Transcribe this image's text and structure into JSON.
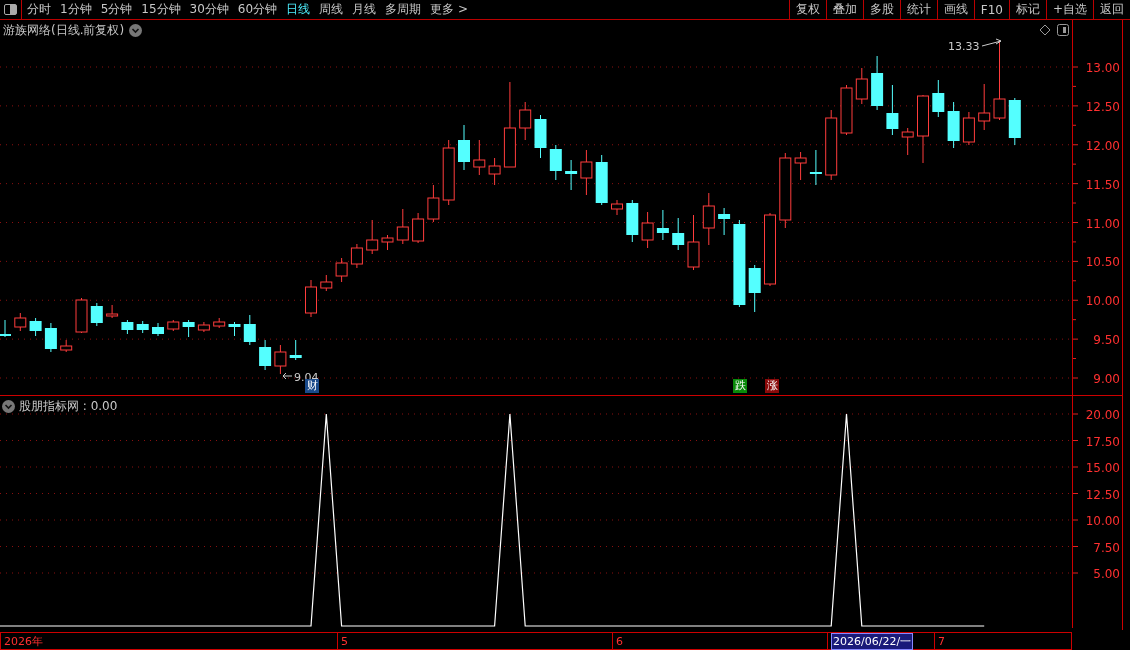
{
  "toolbar": {
    "periods": [
      {
        "label": "分时",
        "selected": false
      },
      {
        "label": "1分钟",
        "selected": false
      },
      {
        "label": "5分钟",
        "selected": false
      },
      {
        "label": "15分钟",
        "selected": false
      },
      {
        "label": "30分钟",
        "selected": false
      },
      {
        "label": "60分钟",
        "selected": false
      },
      {
        "label": "日线",
        "selected": true
      },
      {
        "label": "周线",
        "selected": false
      },
      {
        "label": "月线",
        "selected": false
      },
      {
        "label": "多周期",
        "selected": false
      },
      {
        "label": "更多 >",
        "selected": false
      }
    ],
    "buttons": [
      "复权",
      "叠加",
      "多股",
      "统计",
      "画线",
      "F10",
      "标记",
      "+自选",
      "返回"
    ]
  },
  "price_panel": {
    "title": "游族网络(日线.前复权)",
    "y_ticks": [
      "13.00",
      "12.50",
      "12.00",
      "11.50",
      "11.00",
      "10.50",
      "10.00",
      "9.50",
      "9.00"
    ],
    "high_label": "13.33",
    "low_label": "9.04",
    "markers": [
      {
        "text": "财",
        "kind": "finance"
      },
      {
        "text": "跌",
        "kind": "down"
      },
      {
        "text": "涨",
        "kind": "up"
      }
    ]
  },
  "indicator_panel": {
    "value": " : 0.00",
    "chart_data": {
      "type": "line",
      "grid": true,
      "series": [
        {
          "name": "股朋指标网",
          "color": "#ffffff",
          "values": [
            0,
            0,
            0,
            0,
            0,
            0,
            0,
            0,
            0,
            0,
            0,
            0,
            0,
            0,
            0,
            0,
            0,
            0,
            0,
            0,
            0,
            20,
            0,
            0,
            0,
            0,
            0,
            0,
            0,
            0,
            0,
            0,
            0,
            20,
            0,
            0,
            0,
            0,
            0,
            0,
            0,
            0,
            0,
            0,
            0,
            0,
            0,
            0,
            0,
            0,
            0,
            0,
            0,
            0,
            0,
            20,
            0,
            0,
            0,
            0,
            0,
            0,
            0,
            0,
            0
          ]
        }
      ],
      "ylim": [
        0,
        20
      ],
      "yticks": [
        {
          "value": 5,
          "label": "5.00"
        },
        {
          "value": 7.5,
          "label": "7.50"
        },
        {
          "value": 10,
          "label": "10.00"
        },
        {
          "value": 12.5,
          "label": "12.50"
        },
        {
          "value": 15,
          "label": "15.00"
        },
        {
          "value": 17.5,
          "label": "17.50"
        },
        {
          "value": 20,
          "label": "20.00"
        }
      ]
    }
  },
  "date_bar": [
    {
      "label": "2026年",
      "selected": false
    },
    {
      "label": "5",
      "selected": false
    },
    {
      "label": "6",
      "selected": false
    },
    {
      "label": "2026/06/22/一",
      "selected": true
    },
    {
      "label": "7",
      "selected": false
    }
  ]
}
